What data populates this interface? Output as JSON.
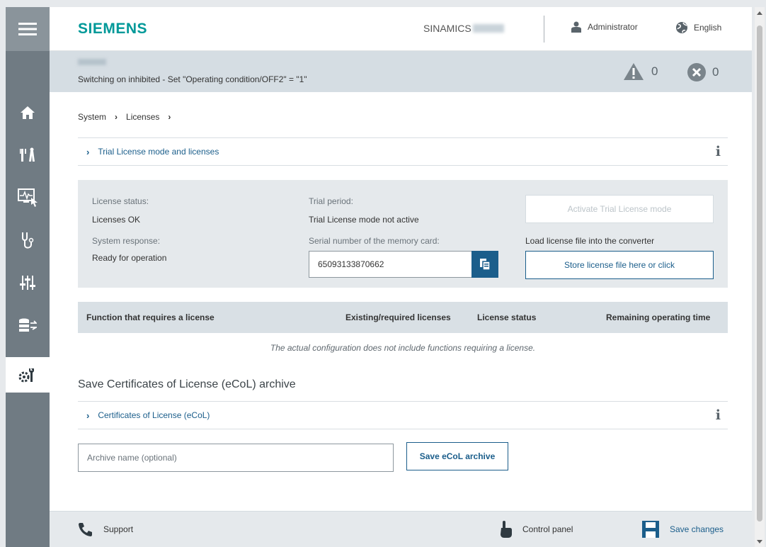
{
  "header": {
    "logo": "SIEMENS",
    "product": "SINAMICS",
    "user": "Administrator",
    "language": "English"
  },
  "status": {
    "message": "Switching on inhibited - Set \"Operating condition/OFF2\" = \"1\"",
    "warnings": "0",
    "errors": "0"
  },
  "breadcrumb": [
    "System",
    "Licenses"
  ],
  "trial_section": {
    "title": "Trial License mode and licenses"
  },
  "license": {
    "status_label": "License status:",
    "status_value": "Licenses OK",
    "response_label": "System response:",
    "response_value": "Ready for operation",
    "trial_label": "Trial period:",
    "trial_value": "Trial License mode not active",
    "serial_label": "Serial number of the memory card:",
    "serial_value": "65093133870662",
    "activate_button": "Activate Trial License mode",
    "load_label": "Load license file into the converter",
    "store_button": "Store license file here or click"
  },
  "table": {
    "columns": [
      "Function that requires a license",
      "Existing/required licenses",
      "License status",
      "Remaining operating time"
    ],
    "empty_message": "The actual configuration does not include functions requiring a license."
  },
  "ecol": {
    "title": "Save Certificates of License (eCoL) archive",
    "section_title": "Certificates of License (eCoL)",
    "archive_placeholder": "Archive name (optional)",
    "save_button": "Save eCoL archive"
  },
  "footer": {
    "support": "Support",
    "control_panel": "Control panel",
    "save_changes": "Save changes"
  },
  "nav": {
    "icons": [
      "menu-icon",
      "home-icon",
      "tools-icon",
      "monitor-icon",
      "diagnostics-icon",
      "parameters-icon",
      "data-icon",
      "settings-icon"
    ],
    "active": "settings-icon"
  },
  "colors": {
    "brand": "#009999",
    "accent": "#1b5e8b",
    "rail": "#707b83",
    "status_bar": "#d5dde3"
  }
}
